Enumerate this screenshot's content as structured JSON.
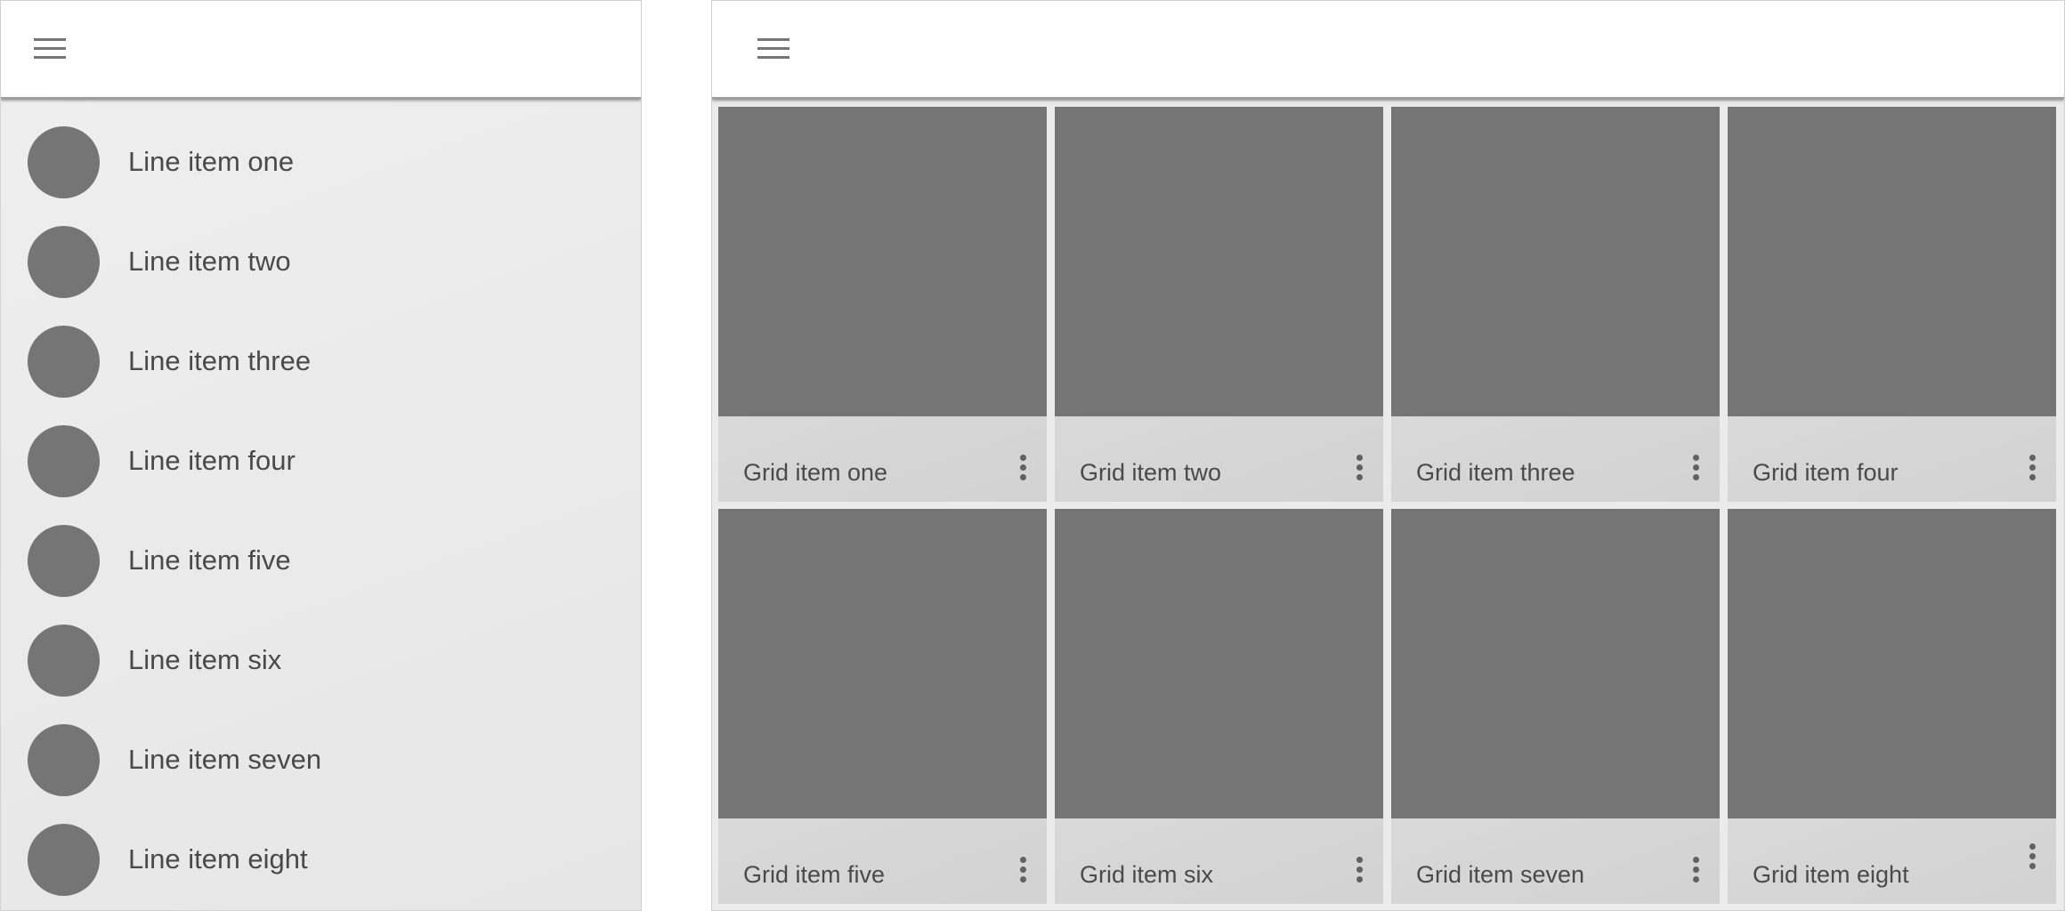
{
  "list_panel": {
    "menu_icon": "hamburger-menu-icon",
    "items": [
      {
        "label": "Line item one"
      },
      {
        "label": "Line item two"
      },
      {
        "label": "Line item three"
      },
      {
        "label": "Line item four"
      },
      {
        "label": "Line item five"
      },
      {
        "label": "Line item six"
      },
      {
        "label": "Line item seven"
      },
      {
        "label": "Line item eight"
      }
    ]
  },
  "grid_panel": {
    "menu_icon": "hamburger-menu-icon",
    "items": [
      {
        "label": "Grid item one"
      },
      {
        "label": "Grid item two"
      },
      {
        "label": "Grid item three"
      },
      {
        "label": "Grid item four"
      },
      {
        "label": "Grid item five"
      },
      {
        "label": "Grid item six"
      },
      {
        "label": "Grid item seven"
      },
      {
        "label": "Grid item eight"
      }
    ]
  },
  "colors": {
    "placeholder": "#757575",
    "text": "#4a4a4a",
    "appbar": "#ffffff",
    "list_background": "#ececec",
    "grid_footer": "#d6d6d6"
  }
}
